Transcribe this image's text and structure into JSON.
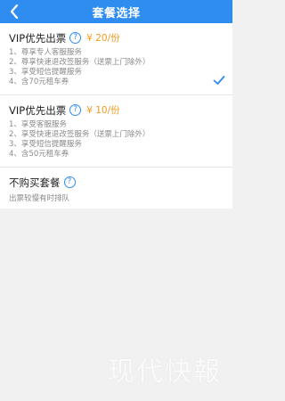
{
  "header": {
    "title": "套餐选择",
    "back_icon": "chevron-left-icon"
  },
  "packages": [
    {
      "name": "VIP优先出票",
      "help_glyph": "?",
      "price": "¥ 20/份",
      "selected": true,
      "features": [
        "1、尊享专人客服服务",
        "2、尊享快速退改签服务（送票上门除外）",
        "3、享受短信提醒服务",
        "4、含70元租车券"
      ]
    },
    {
      "name": "VIP优先出票",
      "help_glyph": "?",
      "price": "¥ 10/份",
      "selected": false,
      "features": [
        "1、享受客服服务",
        "2、享受快速退改签服务（送票上门除外）",
        "3、享受短信提醒服务",
        "4、含50元租车券"
      ]
    }
  ],
  "no_package": {
    "name": "不购买套餐",
    "help_glyph": "?",
    "note": "出票较慢有时排队"
  },
  "watermark": "现代快報",
  "colors": {
    "accent": "#2f8cf0",
    "price": "#f39a1e"
  }
}
